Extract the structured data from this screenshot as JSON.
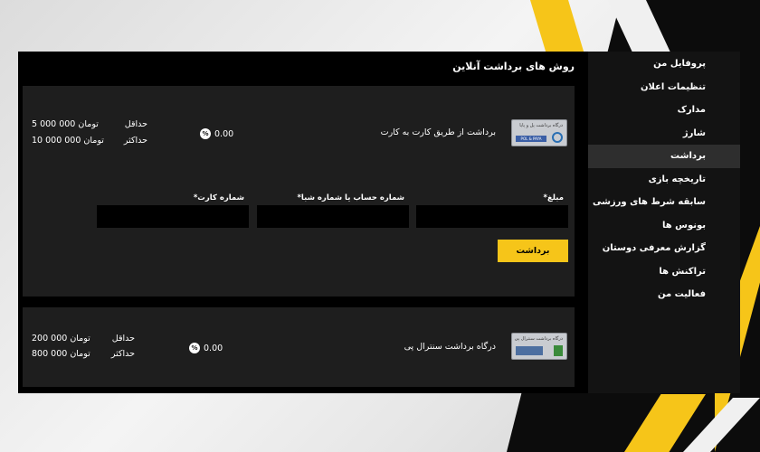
{
  "sidebar": {
    "items": [
      {
        "label": "پروفایل من"
      },
      {
        "label": "تنظیمات اعلان"
      },
      {
        "label": "مدارک"
      },
      {
        "label": "شارژ"
      },
      {
        "label": "برداشت",
        "active": true
      },
      {
        "label": "تاریخچه بازی"
      },
      {
        "label": "سابقه شرط های ورزشی"
      },
      {
        "label": "بونوس ها"
      },
      {
        "label": "گزارش معرفی دوستان"
      },
      {
        "label": "تراکنش ها"
      },
      {
        "label": "فعالیت من"
      }
    ]
  },
  "main": {
    "title": "روش های برداشت آنلاین",
    "methods": [
      {
        "name": "برداشت از طریق کارت به کارت",
        "logo_text": "درگاه برداشت پل و پایا",
        "logo_badge": "POL & PAYA",
        "fee": "0.00",
        "min_label": "حداقل",
        "max_label": "حداکثر",
        "min_value": "5 000 000 تومان",
        "max_value": "10 000 000 تومان",
        "form": {
          "amount_label": "مبلغ*",
          "account_label": "شماره حساب یا شماره شبا*",
          "card_label": "شماره کارت*",
          "amount_value": "",
          "account_value": "",
          "card_value": "",
          "submit_label": "برداشت"
        }
      },
      {
        "name": "درگاه برداشت سنترال پی",
        "logo_text": "درگاه برداشت سنترال پی",
        "fee": "0.00",
        "min_label": "حداقل",
        "max_label": "حداکثر",
        "min_value": "200 000 تومان",
        "max_value": "800 000 تومان"
      }
    ]
  },
  "colors": {
    "accent": "#f6c519",
    "panel": "#1e1e1e",
    "sidebar": "#131313",
    "sidebar_active": "#2e2e2e"
  },
  "icons": {
    "fee": "percent-icon"
  }
}
